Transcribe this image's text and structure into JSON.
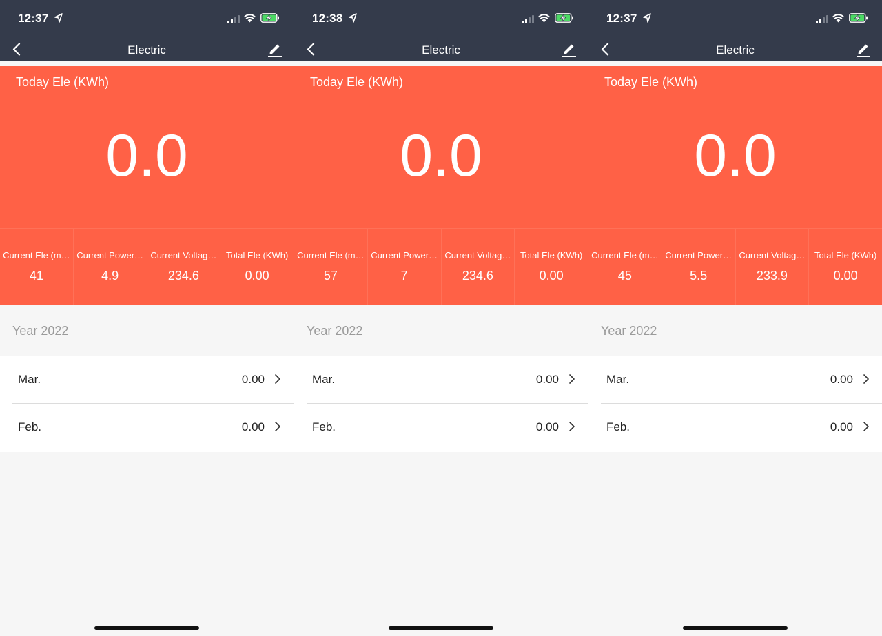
{
  "colors": {
    "header_bg": "#343b4b",
    "accent": "#ff6146",
    "page_bg": "#f6f6f6",
    "battery_fill": "#4cd964"
  },
  "screens": [
    {
      "status_time": "12:37",
      "nav": {
        "title": "Electric"
      },
      "today": {
        "label": "Today Ele (KWh)",
        "value": "0.0"
      },
      "metrics": [
        {
          "label": "Current Ele (m…",
          "value": "41"
        },
        {
          "label": "Current Power…",
          "value": "4.9"
        },
        {
          "label": "Current Voltag…",
          "value": "234.6"
        },
        {
          "label": "Total Ele (KWh)",
          "value": "0.00"
        }
      ],
      "year_label": "Year 2022",
      "months": [
        {
          "name": "Mar.",
          "value": "0.00"
        },
        {
          "name": "Feb.",
          "value": "0.00"
        }
      ]
    },
    {
      "status_time": "12:38",
      "nav": {
        "title": "Electric"
      },
      "today": {
        "label": "Today Ele (KWh)",
        "value": "0.0"
      },
      "metrics": [
        {
          "label": "Current Ele (m…",
          "value": "57"
        },
        {
          "label": "Current Power…",
          "value": "7"
        },
        {
          "label": "Current Voltag…",
          "value": "234.6"
        },
        {
          "label": "Total Ele (KWh)",
          "value": "0.00"
        }
      ],
      "year_label": "Year 2022",
      "months": [
        {
          "name": "Mar.",
          "value": "0.00"
        },
        {
          "name": "Feb.",
          "value": "0.00"
        }
      ]
    },
    {
      "status_time": "12:37",
      "nav": {
        "title": "Electric"
      },
      "today": {
        "label": "Today Ele (KWh)",
        "value": "0.0"
      },
      "metrics": [
        {
          "label": "Current Ele (m…",
          "value": "45"
        },
        {
          "label": "Current Power…",
          "value": "5.5"
        },
        {
          "label": "Current Voltag…",
          "value": "233.9"
        },
        {
          "label": "Total Ele (KWh)",
          "value": "0.00"
        }
      ],
      "year_label": "Year 2022",
      "months": [
        {
          "name": "Mar.",
          "value": "0.00"
        },
        {
          "name": "Feb.",
          "value": "0.00"
        }
      ]
    }
  ]
}
